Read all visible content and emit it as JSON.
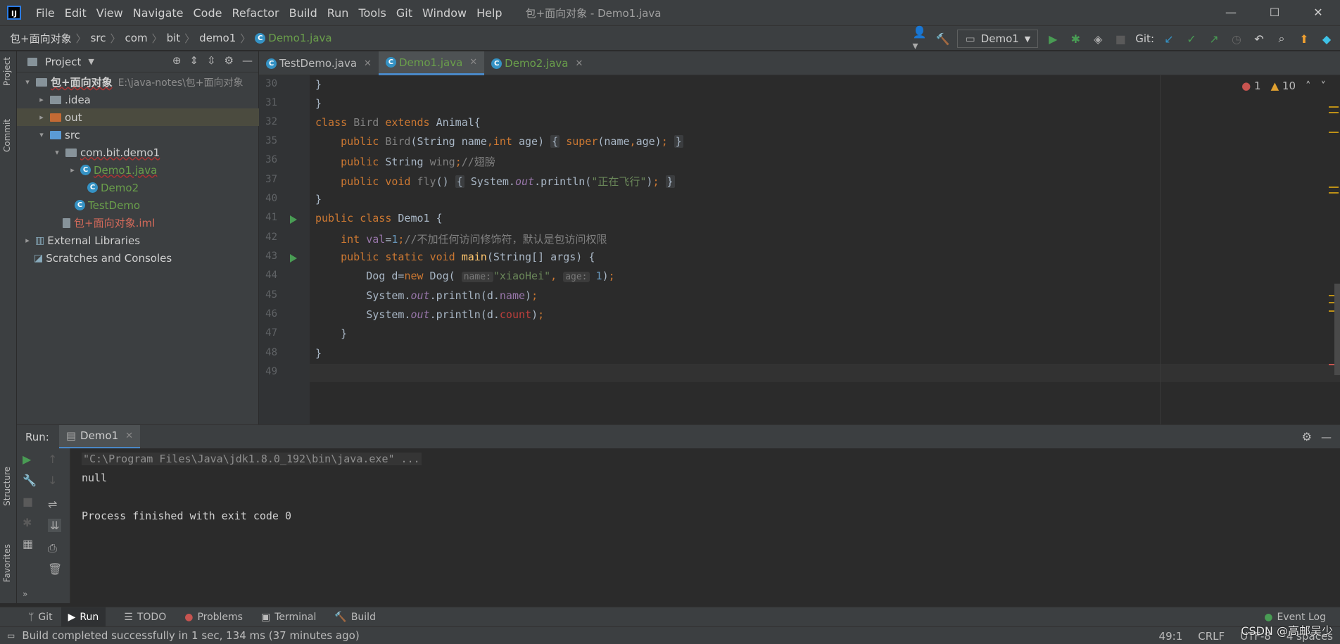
{
  "window": {
    "menu": [
      "File",
      "Edit",
      "View",
      "Navigate",
      "Code",
      "Refactor",
      "Build",
      "Run",
      "Tools",
      "Git",
      "Window",
      "Help"
    ],
    "title": "包+面向对象 - Demo1.java",
    "controls": [
      "—",
      "☐",
      "✕"
    ]
  },
  "breadcrumb": {
    "project": "包+面向对象",
    "src": "src",
    "com": "com",
    "bit": "bit",
    "demo1": "demo1",
    "file": "Demo1.java"
  },
  "toolbar": {
    "run_config": "Demo1",
    "git_label": "Git:"
  },
  "left_strip": {
    "project": "Project",
    "commit": "Commit",
    "structure": "Structure",
    "favorites": "Favorites"
  },
  "project": {
    "title": "Project",
    "root_name": "包+面向对象",
    "root_path": "E:\\java-notes\\包+面向对象",
    "items": [
      {
        "label": "包+面向对象"
      },
      {
        "label": ".idea"
      },
      {
        "label": "out"
      },
      {
        "label": "src"
      },
      {
        "label": "com.bit.demo1"
      },
      {
        "label": "Demo1.java"
      },
      {
        "label": "Demo2"
      },
      {
        "label": "TestDemo"
      },
      {
        "label": "包+面向对象.iml"
      },
      {
        "label": "External Libraries"
      },
      {
        "label": "Scratches and Consoles"
      }
    ]
  },
  "tabs": [
    {
      "label": "TestDemo.java"
    },
    {
      "label": "Demo1.java"
    },
    {
      "label": "Demo2.java"
    }
  ],
  "editor": {
    "errors": "1",
    "warnings": "10",
    "line_numbers": [
      "30",
      "31",
      "32",
      "35",
      "36",
      "37",
      "40",
      "41",
      "42",
      "43",
      "44",
      "45",
      "46",
      "47",
      "48",
      "49"
    ]
  },
  "run": {
    "label": "Run:",
    "tab": "Demo1",
    "console": [
      "\"C:\\Program Files\\Java\\jdk1.8.0_192\\bin\\java.exe\" ...",
      "null",
      "",
      "Process finished with exit code 0"
    ]
  },
  "bottom_tabs": [
    {
      "label": "Git"
    },
    {
      "label": "Run"
    },
    {
      "label": "TODO"
    },
    {
      "label": "Problems"
    },
    {
      "label": "Terminal"
    },
    {
      "label": "Build"
    }
  ],
  "event_log": "Event Log",
  "status": {
    "message": "Build completed successfully in 1 sec, 134 ms (37 minutes ago)",
    "position": "49:1",
    "line_sep": "CRLF",
    "encoding": "UTF-8",
    "indent": "4 spaces",
    "watermark": "CSDN @高邮吴少"
  }
}
